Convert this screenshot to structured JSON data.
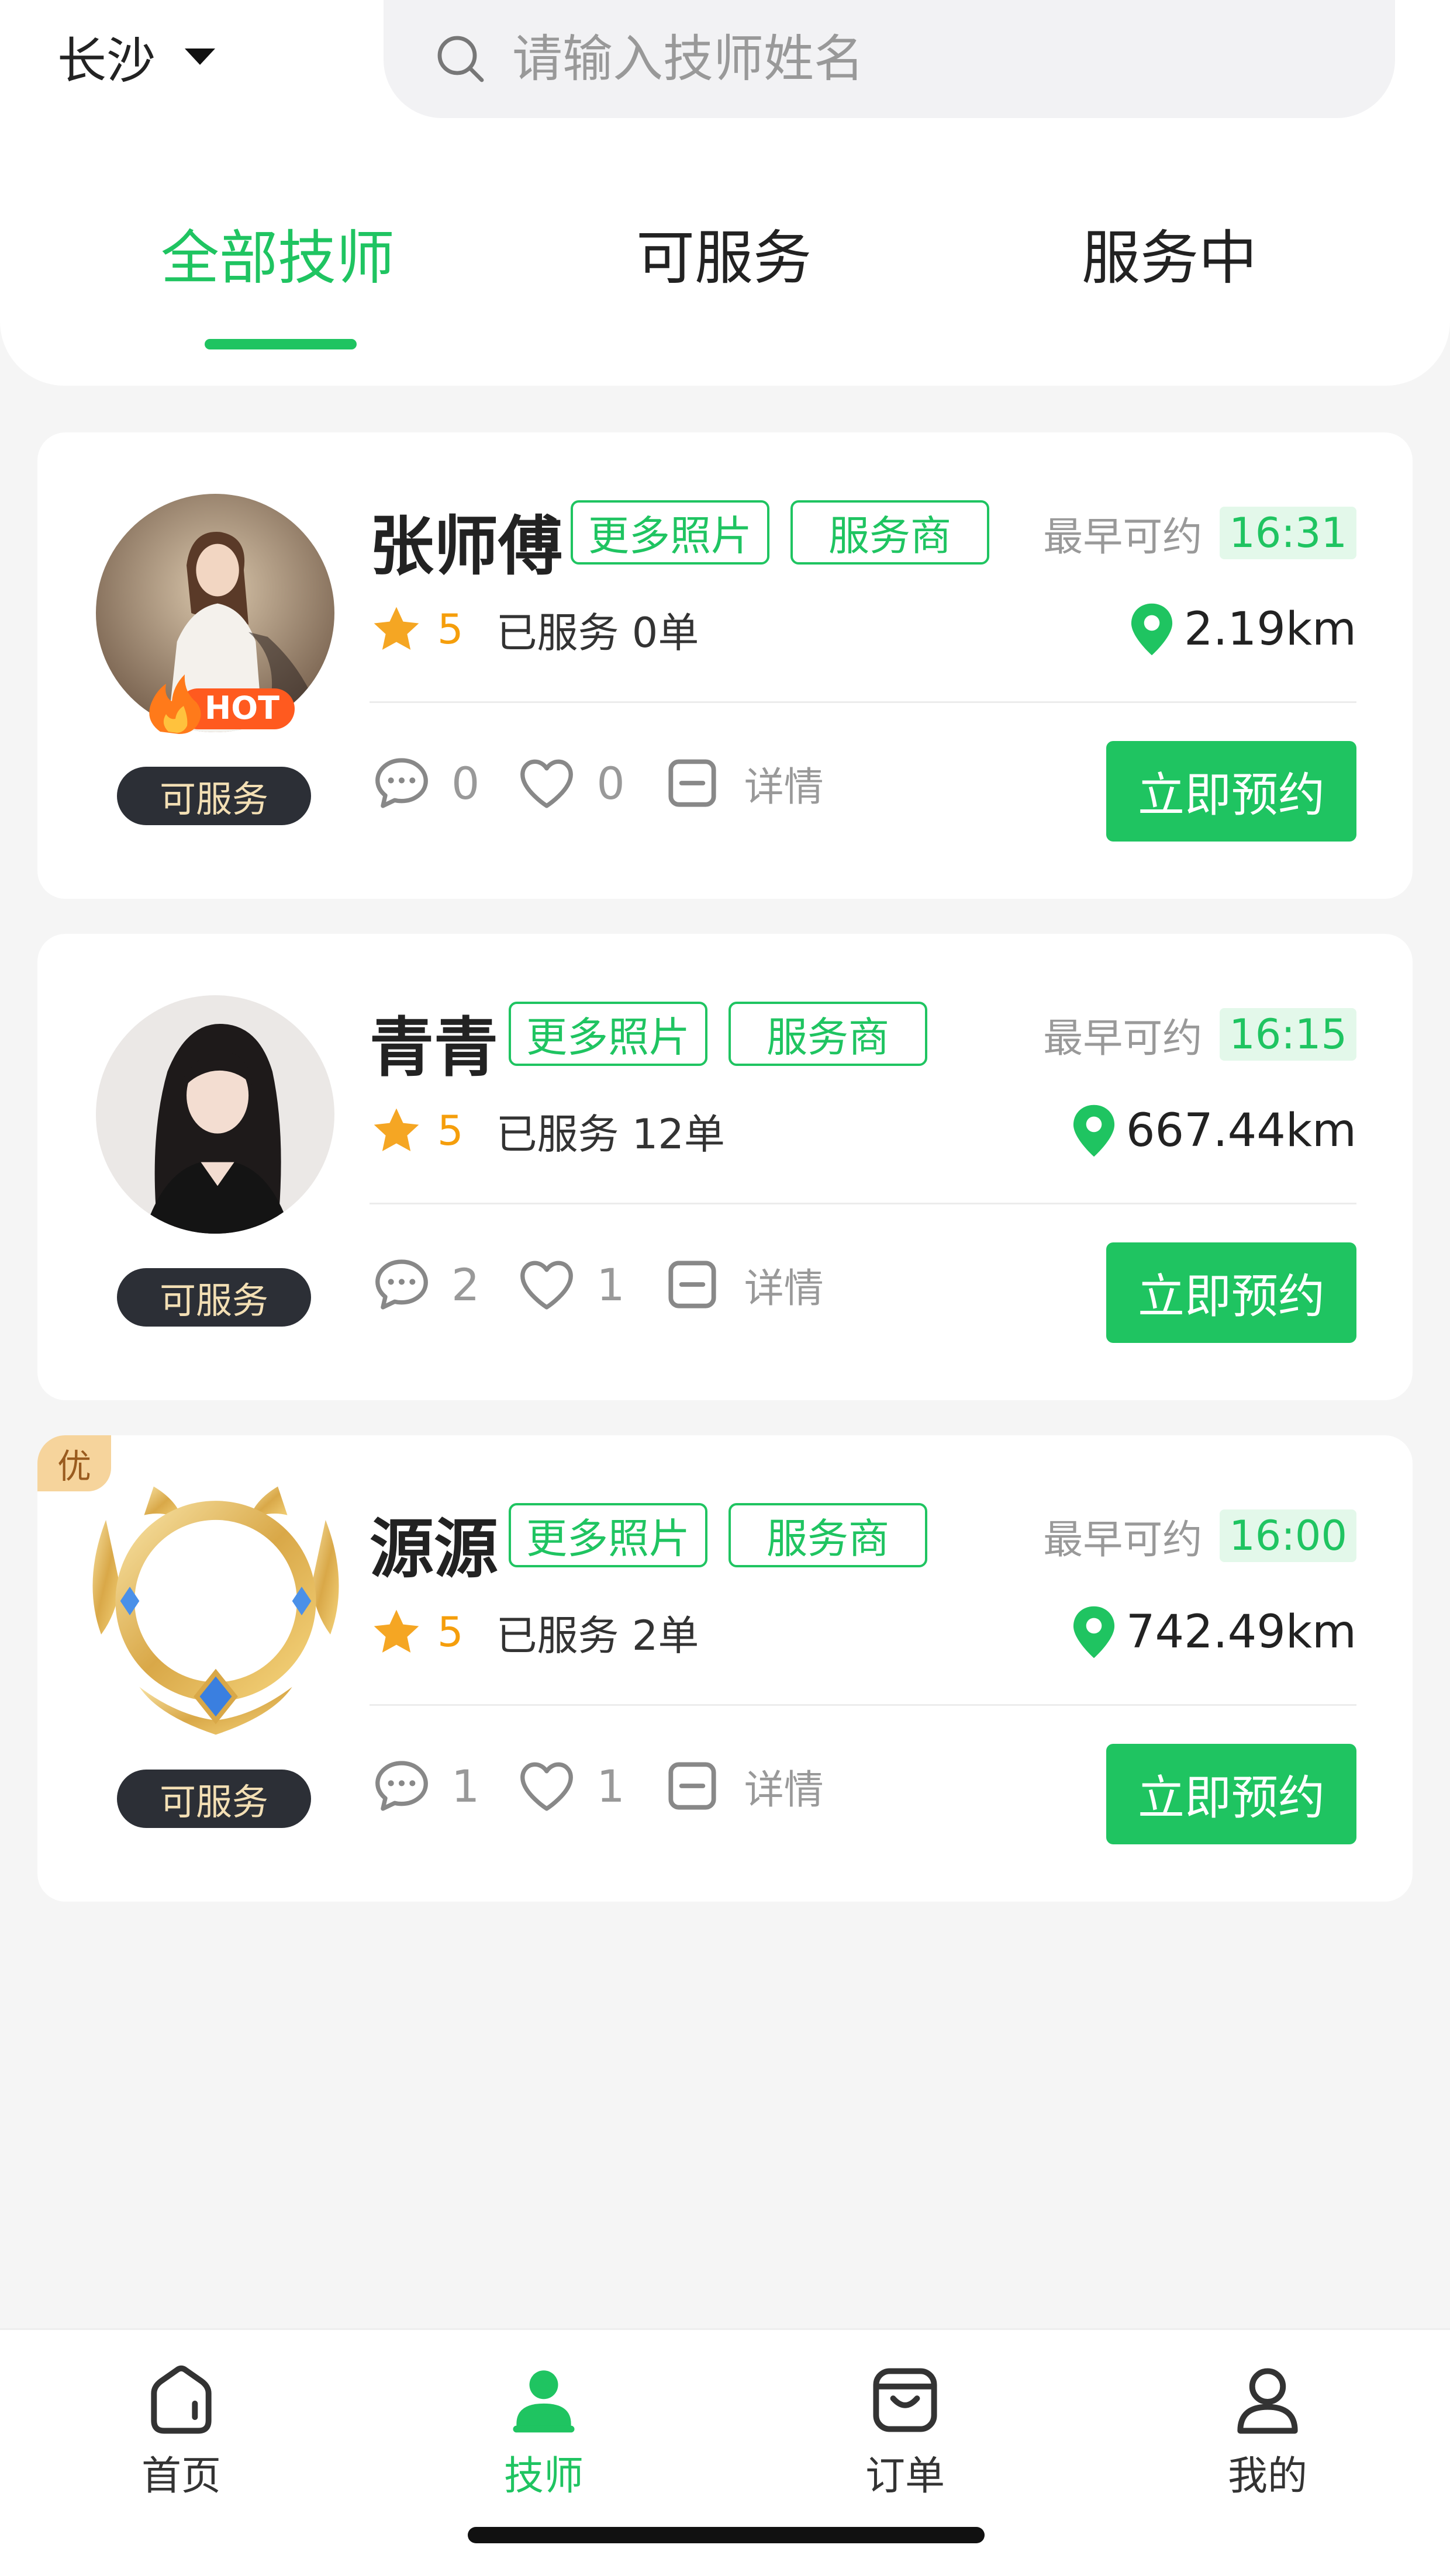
{
  "header": {
    "city": "长沙",
    "search_placeholder": "请输入技师姓名",
    "tabs": [
      {
        "label": "全部技师",
        "active": true
      },
      {
        "label": "可服务",
        "active": false
      },
      {
        "label": "服务中",
        "active": false
      }
    ]
  },
  "technicians": [
    {
      "name": "张师傅",
      "tags": [
        "更多照片",
        "服务商"
      ],
      "earliest_label": "最早可约",
      "earliest_time": "16:31",
      "rating": "5",
      "served": "已服务 0单",
      "distance": "2.19km",
      "comments": "0",
      "likes": "0",
      "detail_label": "详情",
      "status": "可服务",
      "book_label": "立即预约",
      "hot_badge": "HOT"
    },
    {
      "name": "青青",
      "tags": [
        "更多照片",
        "服务商"
      ],
      "earliest_label": "最早可约",
      "earliest_time": "16:15",
      "rating": "5",
      "served": "已服务 12单",
      "distance": "667.44km",
      "comments": "2",
      "likes": "1",
      "detail_label": "详情",
      "status": "可服务",
      "book_label": "立即预约"
    },
    {
      "name": "源源",
      "tags": [
        "更多照片",
        "服务商"
      ],
      "earliest_label": "最早可约",
      "earliest_time": "16:00",
      "rating": "5",
      "served": "已服务 2单",
      "distance": "742.49km",
      "comments": "1",
      "likes": "1",
      "detail_label": "详情",
      "status": "可服务",
      "book_label": "立即预约",
      "corner_badge": "优"
    }
  ],
  "bottom_nav": [
    {
      "label": "首页",
      "icon": "home-icon",
      "active": false
    },
    {
      "label": "技师",
      "icon": "technician-icon",
      "active": true
    },
    {
      "label": "订单",
      "icon": "order-bag-icon",
      "active": false
    },
    {
      "label": "我的",
      "icon": "profile-icon",
      "active": false
    }
  ],
  "colors": {
    "accent": "#1fc461",
    "star": "#f59e0b",
    "status_pill_bg": "#2c2f36",
    "status_pill_text": "#f3dfb4",
    "background": "#f5f5f5"
  }
}
